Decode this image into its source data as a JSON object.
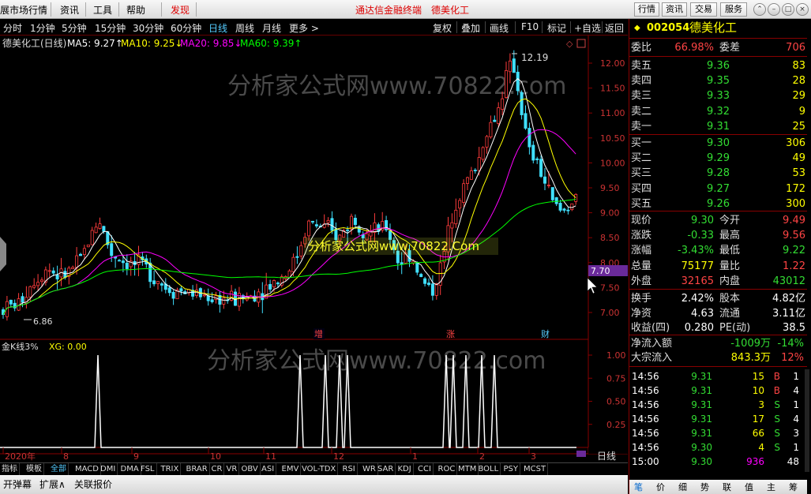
{
  "menu": {
    "items": [
      "展市场行情",
      "资讯",
      "工具",
      "帮助",
      "发现"
    ],
    "center_title": "通达信金融终端",
    "center_stock": "德美化工",
    "right_buttons": [
      "行情",
      "资讯",
      "交易",
      "服务"
    ]
  },
  "period_bar": {
    "periods": [
      "分时",
      "1分钟",
      "5分钟",
      "15分钟",
      "30分钟",
      "60分钟",
      "日线",
      "周线",
      "月线",
      "更多 >"
    ],
    "active": "日线",
    "tools": [
      "复权",
      "叠加",
      "画线",
      "F10",
      "标记",
      "+自选",
      "返回"
    ]
  },
  "chart": {
    "header_title": "德美化工(日线)",
    "ma": [
      {
        "label": "MA5: 9.27↑",
        "color": "#ffffff"
      },
      {
        "label": "MA10: 9.25↓",
        "color": "#ffff00"
      },
      {
        "label": "MA20: 9.85↓",
        "color": "#ff00ff"
      },
      {
        "label": "MA60: 9.39↑",
        "color": "#00ff00"
      }
    ],
    "watermark": "分析家公式网www.70822.com",
    "promo": "分析家公式网www.70822.Com",
    "high_label": "12.19",
    "low_label": "6.86",
    "current_price_tag": "7.70",
    "price_ticks": [
      "12.00",
      "11.50",
      "11.00",
      "10.50",
      "10.00",
      "9.50",
      "9.00",
      "8.50",
      "8.00",
      "7.50",
      "7.00"
    ],
    "markers": [
      "增",
      "涨",
      "财"
    ],
    "indicator_title": "金K线3%",
    "indicator_value": "XG: 0.00",
    "indicator_ticks": [
      "1.00",
      "0.75",
      "0.50",
      "0.25"
    ],
    "date_labels": [
      "2020年",
      "8",
      "9",
      "10",
      "11",
      "12",
      "1",
      "2",
      "3"
    ],
    "period_label": "日线",
    "zoom_buttons": [
      "+",
      "-",
      "0"
    ]
  },
  "chart_data": {
    "type": "candlestick",
    "title": "德美化工(日线)",
    "series_summary": {
      "high": 12.19,
      "low": 6.86,
      "last_ma5": 9.27,
      "last_ma10": 9.25,
      "last_ma20": 9.85,
      "last_ma60": 9.39
    },
    "ylim": [
      6.8,
      12.4
    ]
  },
  "indicator_tabs": [
    "指标",
    "模板",
    "全部",
    "MACD",
    "DMI",
    "DMA",
    "FSL",
    "TRIX",
    "BRAR",
    "CR",
    "VR",
    "OBV",
    "ASI",
    "EMV",
    "VOL-TDX",
    "RSI",
    "WR",
    "SAR",
    "KDJ",
    "CCI",
    "ROC",
    "MTM",
    "BOLL",
    "PSY",
    "MCST"
  ],
  "bottom_bar": [
    "开弹幕",
    "扩展∧",
    "关联报价"
  ],
  "quote": {
    "code": "002054",
    "name": "德美化工",
    "weibi": {
      "label": "委比",
      "value": "66.98%",
      "label2": "委差",
      "value2": "706"
    },
    "asks": [
      {
        "label": "卖五",
        "price": "9.36",
        "vol": "83"
      },
      {
        "label": "卖四",
        "price": "9.35",
        "vol": "28"
      },
      {
        "label": "卖三",
        "price": "9.33",
        "vol": "29"
      },
      {
        "label": "卖二",
        "price": "9.32",
        "vol": "9"
      },
      {
        "label": "卖一",
        "price": "9.31",
        "vol": "25"
      }
    ],
    "bids": [
      {
        "label": "买一",
        "price": "9.30",
        "vol": "306"
      },
      {
        "label": "买二",
        "price": "9.29",
        "vol": "49"
      },
      {
        "label": "买三",
        "price": "9.28",
        "vol": "53"
      },
      {
        "label": "买四",
        "price": "9.27",
        "vol": "172"
      },
      {
        "label": "买五",
        "price": "9.26",
        "vol": "300"
      }
    ],
    "stats": [
      {
        "l1": "现价",
        "v1": "9.30",
        "c1": "g",
        "l2": "今开",
        "v2": "9.49",
        "c2": "r"
      },
      {
        "l1": "涨跌",
        "v1": "-0.33",
        "c1": "g",
        "l2": "最高",
        "v2": "9.56",
        "c2": "r"
      },
      {
        "l1": "涨幅",
        "v1": "-3.43%",
        "c1": "g",
        "l2": "最低",
        "v2": "9.22",
        "c2": "g"
      },
      {
        "l1": "总量",
        "v1": "75177",
        "c1": "y",
        "l2": "量比",
        "v2": "1.22",
        "c2": "r"
      },
      {
        "l1": "外盘",
        "v1": "32165",
        "c1": "r",
        "l2": "内盘",
        "v2": "43012",
        "c2": "g"
      }
    ],
    "stats2": [
      {
        "l1": "换手",
        "v1": "2.42%",
        "c1": "w",
        "l2": "股本",
        "v2": "4.82亿",
        "c2": "w"
      },
      {
        "l1": "净资",
        "v1": "4.63",
        "c1": "w",
        "l2": "流通",
        "v2": "3.11亿",
        "c2": "w"
      },
      {
        "l1": "收益(四)",
        "v1": "0.280",
        "c1": "w",
        "l2": "PE(动)",
        "v2": "38.5",
        "c2": "w"
      }
    ],
    "flows": [
      {
        "label": "净流入额",
        "v1": "-1009万",
        "c1": "g",
        "v2": "-14%",
        "c2": "g"
      },
      {
        "label": "大宗流入",
        "v1": "843.3万",
        "c1": "y",
        "v2": "12%",
        "c2": "r"
      }
    ],
    "ticks": [
      {
        "time": "14:56",
        "price": "9.31",
        "vol": "15",
        "side": "B",
        "n": "1"
      },
      {
        "time": "14:56",
        "price": "9.31",
        "vol": "10",
        "side": "B",
        "n": "4"
      },
      {
        "time": "14:56",
        "price": "9.31",
        "vol": "3",
        "side": "S",
        "n": "1"
      },
      {
        "time": "14:56",
        "price": "9.31",
        "vol": "17",
        "side": "S",
        "n": "4"
      },
      {
        "time": "14:56",
        "price": "9.31",
        "vol": "66",
        "side": "S",
        "n": "3"
      },
      {
        "time": "14:56",
        "price": "9.30",
        "vol": "4",
        "side": "S",
        "n": "1"
      },
      {
        "time": "15:00",
        "price": "9.30",
        "vol": "936",
        "side": "",
        "n": "48"
      }
    ],
    "tabs": [
      "笔",
      "价",
      "细",
      "势",
      "联",
      "值",
      "主",
      "筹"
    ]
  },
  "colors": {
    "up": "#ff3c3c",
    "down": "#40e0ff",
    "ma5": "#ffffff",
    "ma10": "#ffff00",
    "ma20": "#ff00ff",
    "ma60": "#00ff00",
    "accent": "#800000"
  }
}
